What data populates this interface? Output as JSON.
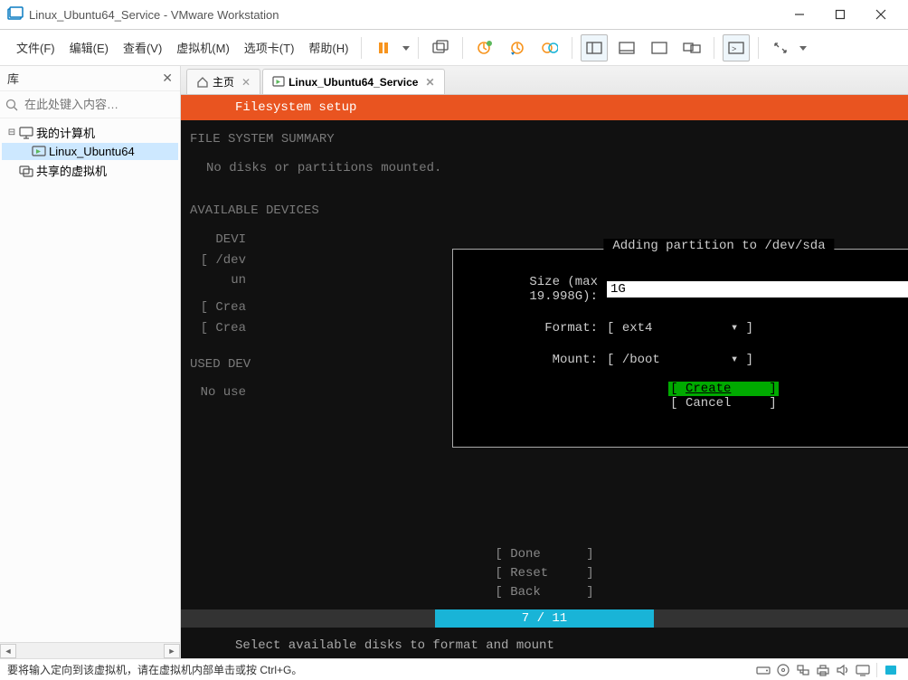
{
  "window": {
    "title": "Linux_Ubuntu64_Service - VMware Workstation"
  },
  "menubar": {
    "file": "文件(F)",
    "edit": "编辑(E)",
    "view": "查看(V)",
    "vm": "虚拟机(M)",
    "tabs": "选项卡(T)",
    "help": "帮助(H)"
  },
  "sidebar": {
    "header": "库",
    "search_placeholder": "在此处键入内容…",
    "tree": {
      "root_label": "我的计算机",
      "node1": "Linux_Ubuntu64",
      "node2": "共享的虚拟机"
    }
  },
  "tabs": {
    "home": "主页",
    "vm": "Linux_Ubuntu64_Service"
  },
  "vm": {
    "header": "Filesystem setup",
    "summary_title": "FILE SYSTEM SUMMARY",
    "summary_msg": "No disks or partitions mounted.",
    "avail_title": "AVAILABLE DEVICES",
    "devi": "DEVI",
    "dev2": "[ /dev",
    "un": "un",
    "crea1": "[ Crea",
    "crea2": "[ Crea",
    "used_title": "USED DEV",
    "no_use": "No use",
    "dialog": {
      "title": "Adding partition to /dev/sda",
      "size_label": "Size (max 19.998G):",
      "size_value": "1G",
      "format_label": "Format:",
      "format_value": "ext4",
      "mount_label": "Mount:",
      "mount_value": "/boot",
      "create": "Create",
      "cancel": "Cancel"
    },
    "done": "Done",
    "reset": "Reset",
    "back": "Back",
    "progress": "7 / 11",
    "hint": "Select available disks to format and mount"
  },
  "statusbar": {
    "msg": "要将输入定向到该虚拟机，请在虚拟机内部单击或按 Ctrl+G。"
  }
}
